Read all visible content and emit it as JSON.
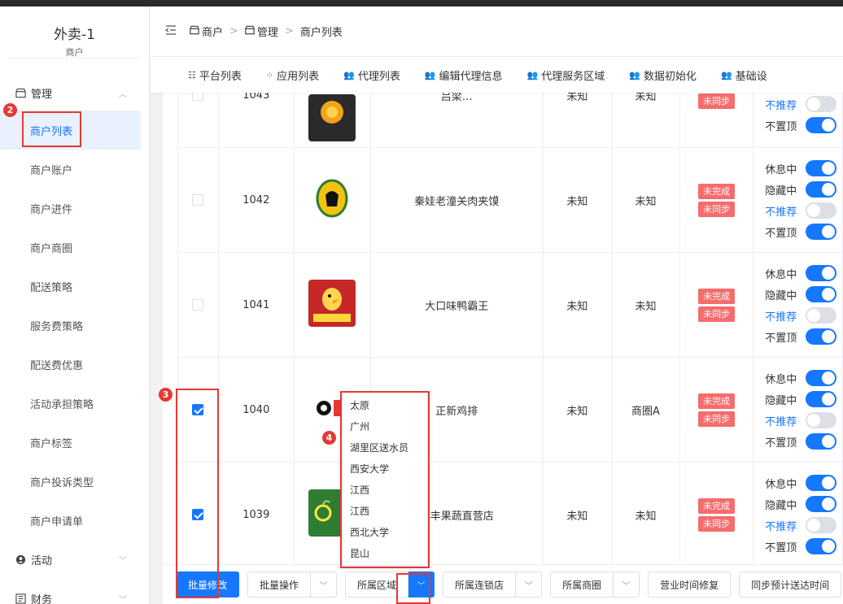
{
  "app": {
    "title": "外卖-1",
    "subtitle": "商户"
  },
  "sidebar": {
    "group_manage": "管理",
    "group_activity": "活动",
    "group_finance": "财务",
    "items": [
      {
        "label": "商户列表",
        "active": true
      },
      {
        "label": "商户账户"
      },
      {
        "label": "商户进件"
      },
      {
        "label": "商户商圈"
      },
      {
        "label": "配送策略"
      },
      {
        "label": "服务费策略"
      },
      {
        "label": "配送费优惠"
      },
      {
        "label": "活动承担策略"
      },
      {
        "label": "商户标签"
      },
      {
        "label": "商户投诉类型"
      },
      {
        "label": "商户申请单"
      }
    ]
  },
  "breadcrumb": {
    "c1": "商户",
    "c2": "管理",
    "c3": "商户列表"
  },
  "tabs": [
    "平台列表",
    "应用列表",
    "代理列表",
    "编辑代理信息",
    "代理服务区域",
    "数据初始化",
    "基础设"
  ],
  "switch_labels": {
    "rest": "休息中",
    "hide": "隐藏中",
    "norec": "不推荐",
    "notop": "不置顶"
  },
  "tags": {
    "incomplete": "未完成",
    "unsynced": "未同步"
  },
  "rows": [
    {
      "id": "1043",
      "name": "吕梁…",
      "a": "未知",
      "b": "未知"
    },
    {
      "id": "1042",
      "name": "秦娃老潼关肉夹馍",
      "a": "未知",
      "b": "未知"
    },
    {
      "id": "1041",
      "name": "大口味鸭霸王",
      "a": "未知",
      "b": "未知"
    },
    {
      "id": "1040",
      "name": "正新鸡排",
      "a": "未知",
      "b": "商圈A"
    },
    {
      "id": "1039",
      "name": "鲜丰果蔬直营店",
      "a": "未知",
      "b": "未知"
    }
  ],
  "dropdown_options": [
    "太原",
    "广州",
    "湖里区送水员",
    "西安大学",
    "江西",
    "江西",
    "西北大学",
    "昆山"
  ],
  "bottom": {
    "batch_edit": "批量修改",
    "batch_ops": "批量操作",
    "region": "所属区域",
    "chain": "所属连锁店",
    "circle": "所属商圈",
    "hours_fix": "营业时间修复",
    "sync_eta": "同步预计送达时间",
    "more": "同"
  },
  "badges": {
    "b2": "2",
    "b3": "3",
    "b4": "4"
  },
  "colors": {
    "primary": "#1677ff",
    "danger": "#f56c6c",
    "annotation": "#e53935"
  }
}
